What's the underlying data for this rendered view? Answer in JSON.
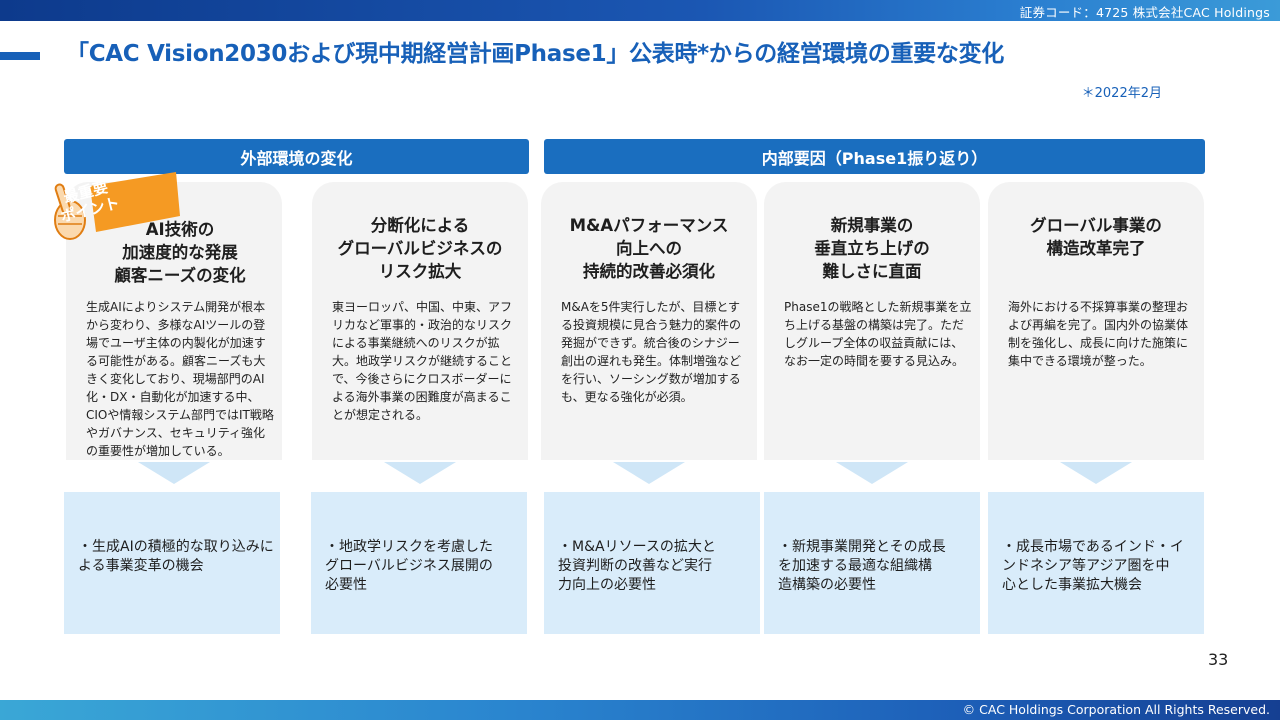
{
  "header": {
    "stock_info": "証券コード：4725 株式会社CAC Holdings"
  },
  "title": "「CAC Vision2030および現中期経営計画Phase1」公表時*からの経営環境の重要な変化",
  "date_note": "＊2022年2月",
  "sections": {
    "external": "外部環境の変化",
    "internal": "内部要因（Phase1振り返り）"
  },
  "badge": {
    "label": "最重要\nポイント"
  },
  "cards": [
    {
      "title": "AI技術の\n加速度的な発展\n顧客ニーズの変化",
      "body": "生成AIによりシステム開発が根本から変わり、多様なAIツールの登場でユーザ主体の内製化が加速する可能性がある。顧客ニーズも大きく変化しており、現場部門のAI化・DX・自動化が加速する中、CIOや情報システム部門ではIT戦略やガバナンス、セキュリティ強化の重要性が増加している。",
      "box": "・生成AIの積極的な取り込みに\nよる事業変革の機会"
    },
    {
      "title": "分断化による\nグローバルビジネスの\nリスク拡大",
      "body": "東ヨーロッパ、中国、中東、アフリカなど軍事的・政治的なリスクによる事業継続へのリスクが拡大。地政学リスクが継続することで、今後さらにクロスボーダーによる海外事業の困難度が高まることが想定される。",
      "box": "・地政学リスクを考慮した\nグローバルビジネス展開の\n必要性"
    },
    {
      "title": "M&Aパフォーマンス\n向上への\n持続的改善必須化",
      "body": "M&Aを5件実行したが、目標とする投資規模に見合う魅力的案件の発掘ができず。統合後のシナジー創出の遅れも発生。体制増強などを行い、ソーシング数が増加するも、更なる強化が必須。",
      "box": "・M&Aリソースの拡大と\n投資判断の改善など実行\n力向上の必要性"
    },
    {
      "title": "新規事業の\n垂直立ち上げの\n難しさに直面",
      "body": "Phase1の戦略とした新規事業を立ち上げる基盤の構築は完了。ただしグループ全体の収益貢献には、なお一定の時間を要する見込み。",
      "box": "・新規事業開発とその成長\nを加速する最適な組織構\n造構築の必要性"
    },
    {
      "title": "グローバル事業の\n構造改革完了",
      "body": "海外における不採算事業の整理および再編を完了。国内外の協業体制を強化し、成長に向けた施策に集中できる環境が整った。",
      "box": "・成長市場であるインド・イ\nンドネシア等アジア圏を中\n心とした事業拡大機会"
    }
  ],
  "page_number": "33",
  "footer": {
    "copyright": "© CAC Holdings Corporation All Rights Reserved."
  },
  "colors": {
    "primary": "#1760b8",
    "section_header": "#1a6ebf",
    "card_bg": "#f3f3f3",
    "box_bg": "#d9ecfa",
    "badge": "#f59a23"
  }
}
